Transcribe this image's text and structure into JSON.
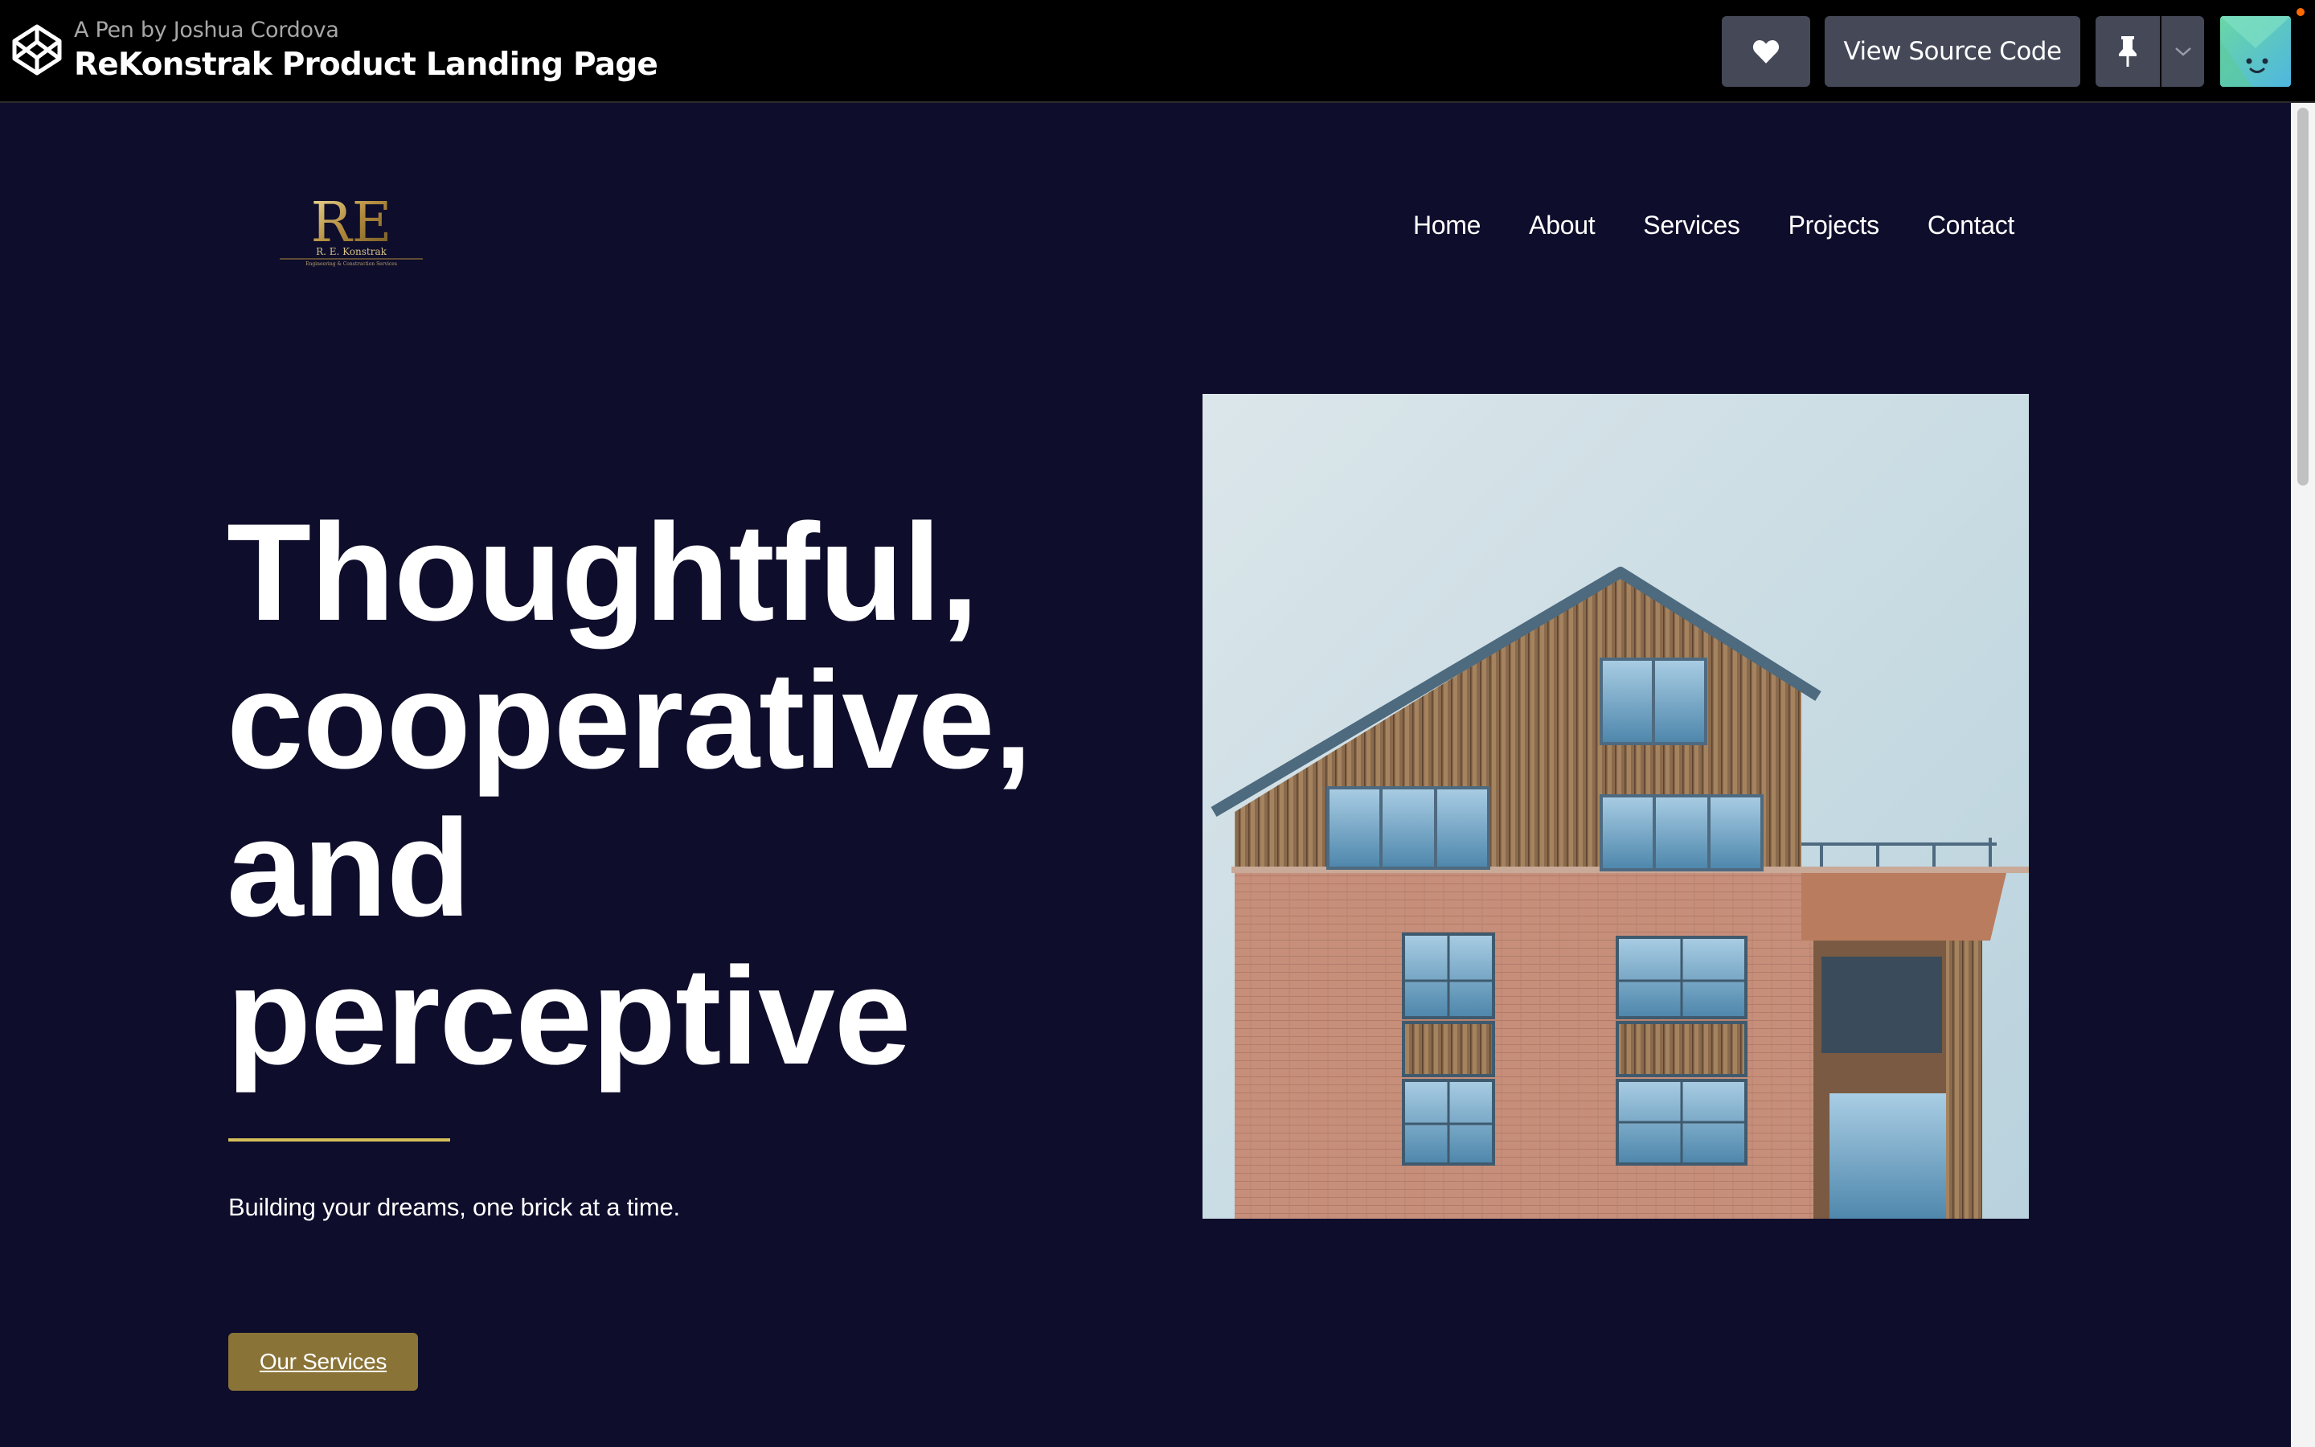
{
  "codepen": {
    "byline_prefix": "A Pen by",
    "author": "Joshua Cordova",
    "title": "ReKonstrak Product Landing Page",
    "view_source_label": "View Source Code"
  },
  "site": {
    "logo_monogram": "RE",
    "logo_name": "R. E. Konstrak",
    "logo_tagline": "Engineering & Construction Services",
    "nav": [
      {
        "label": "Home"
      },
      {
        "label": "About"
      },
      {
        "label": "Services"
      },
      {
        "label": "Projects"
      },
      {
        "label": "Contact"
      }
    ],
    "hero": {
      "title_lines": [
        "Thoughtful,",
        "cooperative,",
        "and",
        "perceptive"
      ],
      "tagline": "Building your dreams, one brick at a time.",
      "cta_label": "Our Services"
    }
  },
  "colors": {
    "page_bg": "#0e0d2b",
    "accent_gold": "#d4bf5a",
    "cta_bg": "#8a7337",
    "topbar_bg": "#000000",
    "topbar_button": "#444857"
  },
  "icons": {
    "codepen": "codepen-logo-icon",
    "heart": "heart-icon",
    "pin": "pin-icon",
    "caret": "chevron-down-icon"
  }
}
